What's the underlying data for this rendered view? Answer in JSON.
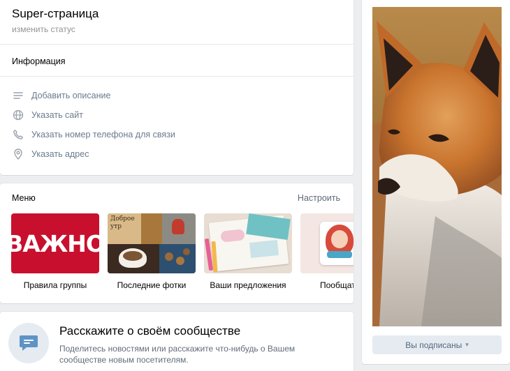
{
  "header": {
    "title": "Super-страница",
    "status_link": "изменить статус"
  },
  "info": {
    "heading": "Информация",
    "rows": [
      {
        "icon": "lines-icon",
        "label": "Добавить описание"
      },
      {
        "icon": "globe-icon",
        "label": "Указать сайт"
      },
      {
        "icon": "phone-icon",
        "label": "Указать номер телефона для связи"
      },
      {
        "icon": "location-pin-icon",
        "label": "Указать адрес"
      }
    ]
  },
  "menu": {
    "title": "Меню",
    "configure": "Настроить",
    "items": [
      {
        "label": "Правила группы",
        "image_text": "ВАЖНО"
      },
      {
        "label": "Последние фотки",
        "image_text": "Доброе утр"
      },
      {
        "label": "Ваши предложения"
      },
      {
        "label": "Пообщат"
      }
    ]
  },
  "tell": {
    "title": "Расскажите о своём сообществе",
    "text": "Поделитесь новостями или расскажите что-нибудь о Вашем сообществе новым посетителям."
  },
  "cover": {
    "subscribed_label": "Вы подписаны",
    "image": "fox-photo"
  },
  "colors": {
    "background": "#edeef0",
    "link": "#6b7b8e",
    "accent_red": "#c8102e",
    "button_bg": "#e5ebf1"
  }
}
